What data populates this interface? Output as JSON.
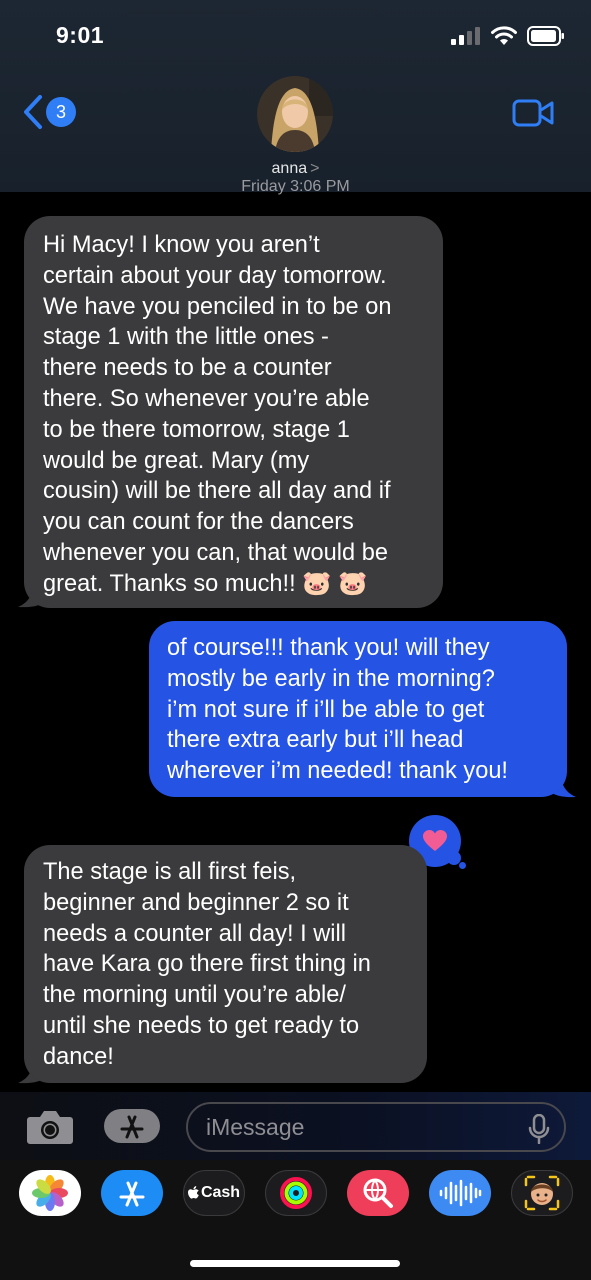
{
  "status_bar": {
    "time": "9:01"
  },
  "header": {
    "back_badge": "3",
    "contact_name": "anna",
    "contact_chevron": ">",
    "timestamp": "Friday 3:06 PM"
  },
  "messages": [
    {
      "direction": "incoming",
      "lines": [
        "Hi Macy! I know you aren’t",
        "certain about your day tomorrow.",
        "We have you penciled in to be on",
        "stage 1 with the little ones -",
        "there needs to be a counter",
        "there. So whenever you’re able",
        "to be there tomorrow, stage 1",
        "would be great. Mary (my",
        "cousin) will be there all day and if",
        "you can count for the dancers",
        "whenever you can, that would be",
        "great. Thanks so much!! 🐷 🐷"
      ]
    },
    {
      "direction": "outgoing",
      "lines": [
        "of course!!! thank you! will they",
        "mostly be early in the morning?",
        "i’m not sure if i’ll be able to get",
        "there extra early but i’ll head",
        "wherever i’m needed! thank you!"
      ],
      "tapback": "heart"
    },
    {
      "direction": "incoming",
      "lines": [
        "The stage is all first feis,",
        "beginner and beginner 2 so it",
        "needs a counter all day! I will",
        "have Kara go there first thing in",
        "the morning until you’re able/",
        "until she needs to get ready to",
        "dance!"
      ]
    }
  ],
  "composer": {
    "placeholder": "iMessage"
  },
  "app_drawer": {
    "apps": [
      "photos-icon",
      "app-store-icon",
      "apple-cash-icon",
      "activity-icon",
      "images-search-icon",
      "audio-message-icon",
      "memoji-icon"
    ],
    "cash_label": "Cash"
  },
  "colors": {
    "incoming_bubble": "#3b3b3d",
    "outgoing_bubble": "#2553e3",
    "accent": "#2f7ef6",
    "heart": "#f25c95"
  }
}
